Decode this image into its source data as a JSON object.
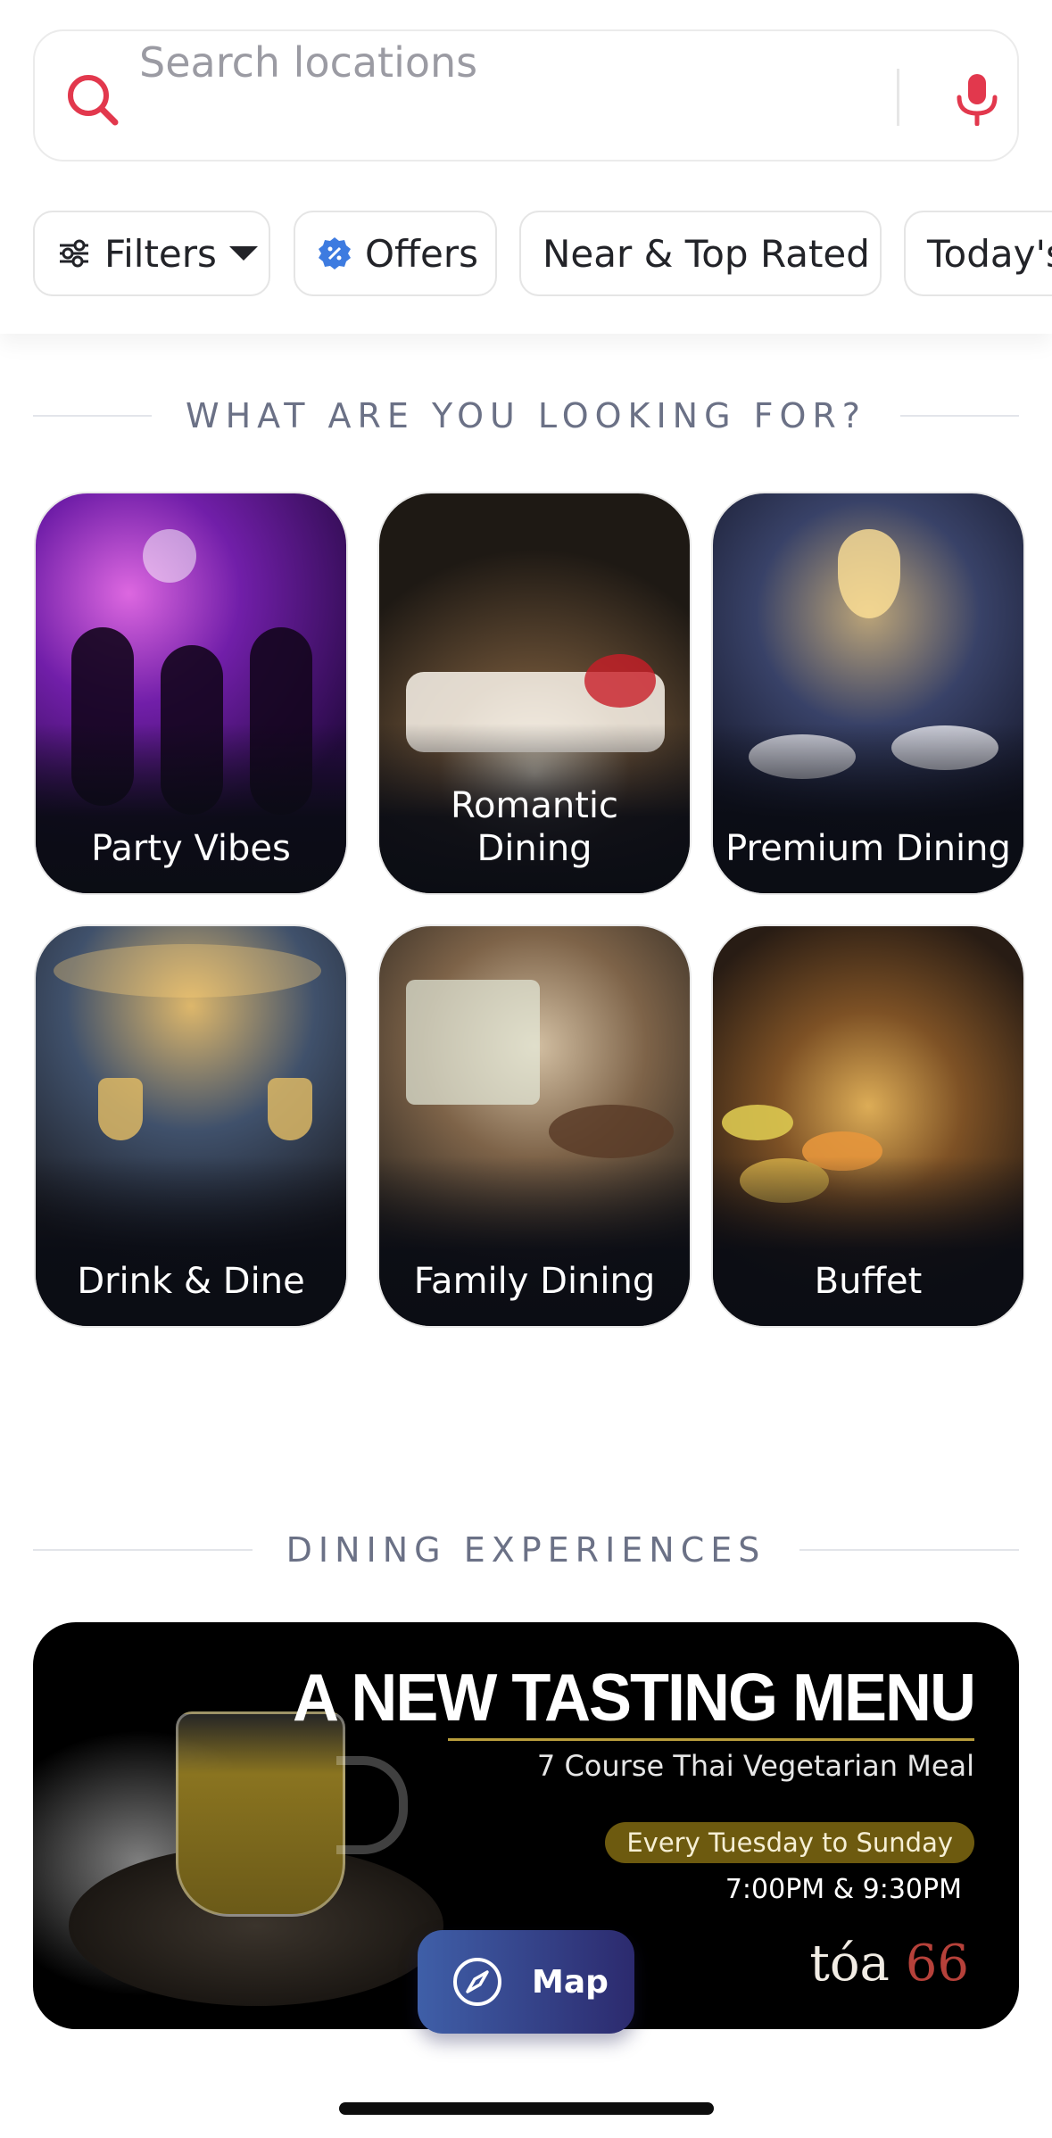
{
  "search": {
    "placeholder": "Search locations"
  },
  "filters": [
    {
      "label": "Filters"
    },
    {
      "label": "Offers"
    },
    {
      "label": "Near & Top Rated"
    },
    {
      "label": "Today's"
    }
  ],
  "looking_for": {
    "title": "WHAT ARE YOU LOOKING FOR?",
    "items": [
      {
        "label": "Party Vibes"
      },
      {
        "label": "Romantic Dining"
      },
      {
        "label": "Premium Dining"
      },
      {
        "label": "Drink & Dine"
      },
      {
        "label": "Family Dining"
      },
      {
        "label": "Buffet"
      }
    ]
  },
  "experiences": {
    "title": "DINING EXPERIENCES",
    "banner": {
      "headline": "A NEW TASTING MENU",
      "subtitle": "7 Course Thai Vegetarian Meal",
      "schedule": "Every Tuesday to Sunday",
      "times": "7:00PM & 9:30PM",
      "brand_name": "tóa",
      "brand_number": "66"
    }
  },
  "map_button": {
    "label": "Map"
  },
  "colors": {
    "accent": "#e2384d",
    "offers_badge": "#3d7be0",
    "map_button": "#34438c",
    "banner_pill": "#6d5a0f"
  }
}
